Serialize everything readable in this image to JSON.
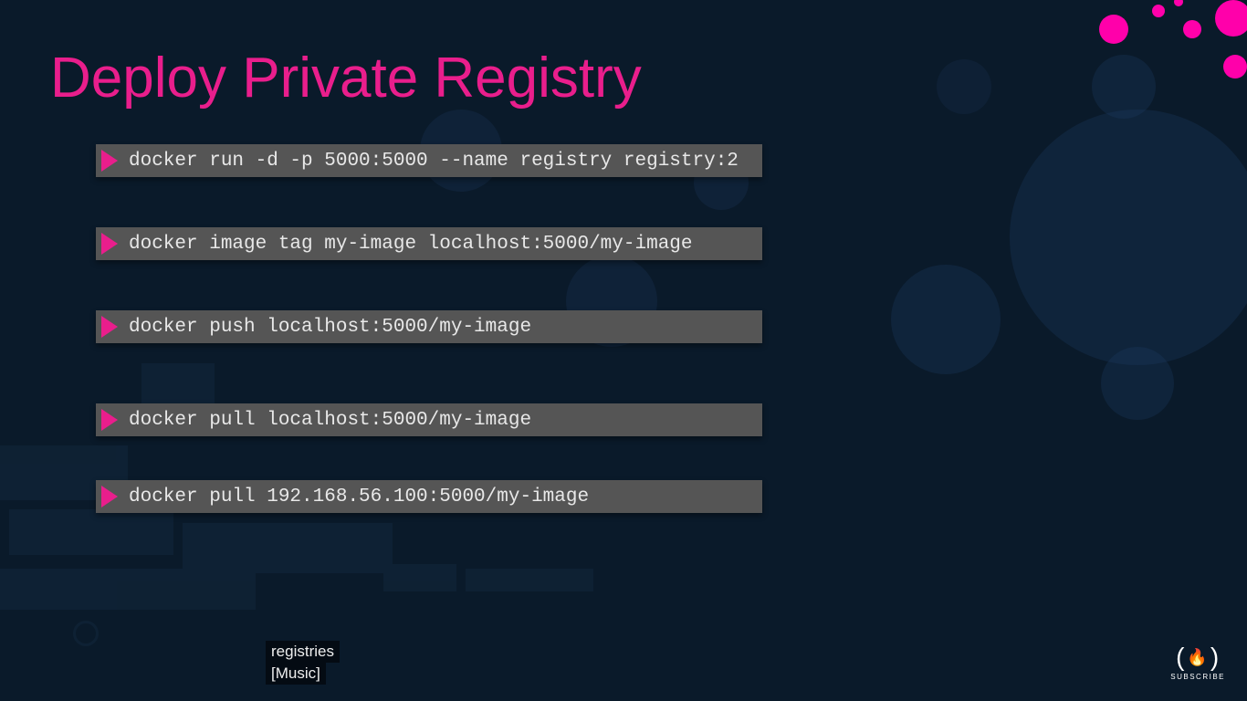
{
  "title": "Deploy Private Registry",
  "commands": [
    "docker run -d -p 5000:5000 --name registry registry:2",
    "docker image tag my-image localhost:5000/my-image",
    "docker push localhost:5000/my-image",
    "docker pull localhost:5000/my-image",
    "docker pull 192.168.56.100:5000/my-image"
  ],
  "captions": {
    "line1": "registries",
    "line2": "[Music]"
  },
  "subscribe": {
    "label": "SUBSCRIBE"
  },
  "colors": {
    "accent": "#e91e8c",
    "background": "#0a1a2a",
    "command_bg": "#555555"
  }
}
